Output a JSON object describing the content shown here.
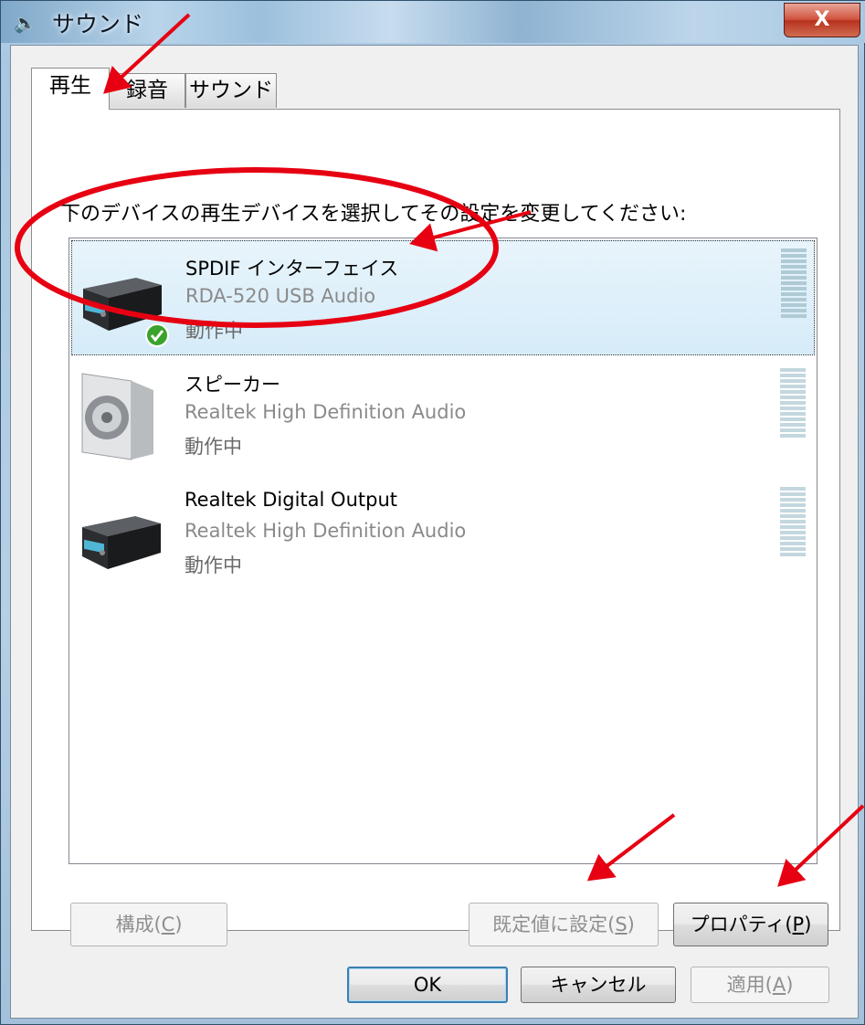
{
  "window": {
    "title": "サウンド",
    "close_label": "X"
  },
  "tabs": [
    {
      "label": "再生",
      "active": true
    },
    {
      "label": "録音",
      "active": false
    },
    {
      "label": "サウンド",
      "active": false
    }
  ],
  "instruction": "下のデバイスの再生デバイスを選択してその設定を変更してください:",
  "devices": [
    {
      "name": "SPDIF インターフェイス",
      "driver": "RDA-520 USB Audio",
      "status": "動作中",
      "selected": true,
      "default": true,
      "icon": "receiver-icon"
    },
    {
      "name": "スピーカー",
      "driver": "Realtek High Definition Audio",
      "status": "動作中",
      "selected": false,
      "default": false,
      "icon": "speaker-icon"
    },
    {
      "name": "Realtek Digital Output",
      "driver": "Realtek High Definition Audio",
      "status": "動作中",
      "selected": false,
      "default": false,
      "icon": "receiver-icon"
    }
  ],
  "buttons": {
    "configure": {
      "label": "構成(",
      "key": "C",
      "end": ")"
    },
    "set_default": {
      "label": "既定値に設定(",
      "key": "S",
      "end": ")"
    },
    "properties": {
      "label": "プロパティ(",
      "key": "P",
      "end": ")"
    },
    "ok": "OK",
    "cancel": "キャンセル",
    "apply": {
      "label": "適用(",
      "key": "A",
      "end": ")"
    }
  },
  "colors": {
    "annotation_red": "#e60012",
    "selection_bg": "#d6ecf9",
    "default_check": "#3aa32c"
  }
}
